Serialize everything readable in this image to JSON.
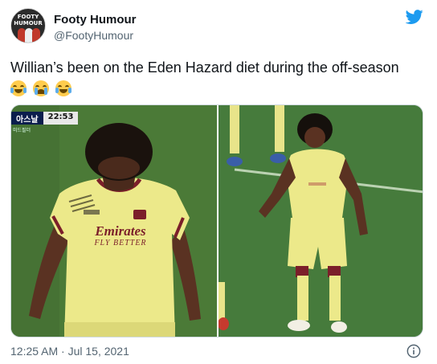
{
  "tweet": {
    "author_name": "Footy Humour",
    "author_handle": "@FootyHumour",
    "avatar_text": "FOOTY HUMOUR",
    "text": "Willian’s been on the Eden Hazard diet during the off-season",
    "emojis": [
      "tears-of-joy-emoji",
      "loudly-crying-emoji",
      "tears-of-joy-emoji"
    ],
    "timestamp": "12:25 AM · Jul 15, 2021"
  },
  "media": {
    "left_image": {
      "scoreboard_team": "아스날",
      "scoreboard_time": "22:53",
      "scoreboard_sub": "미드필더",
      "shirt_sponsor_line1": "Emirates",
      "shirt_sponsor_line2": "FLY BETTER"
    }
  },
  "colors": {
    "twitter_blue": "#1d9bf0",
    "kit_yellow": "#ece98a",
    "kit_trim": "#7b1f2a",
    "pitch_green": "#4a7d3a"
  },
  "icons": [
    "twitter-bird-icon",
    "info-icon"
  ]
}
